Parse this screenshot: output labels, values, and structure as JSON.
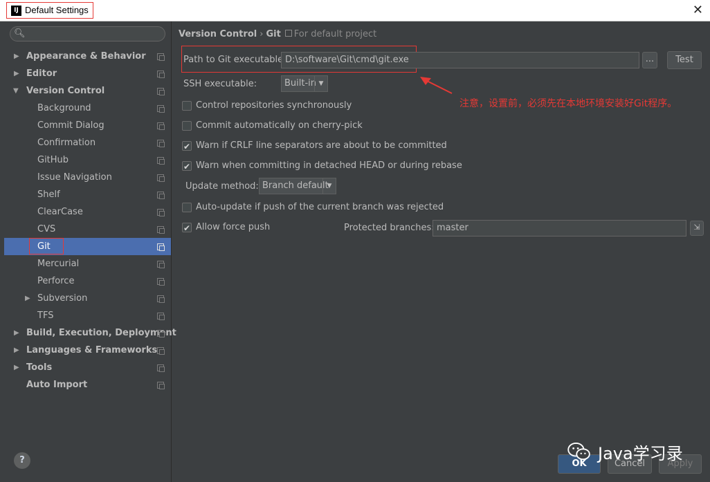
{
  "window": {
    "title": "Default Settings"
  },
  "search": {
    "placeholder": ""
  },
  "sidebar": {
    "items": [
      {
        "label": "Appearance & Behavior"
      },
      {
        "label": "Editor"
      },
      {
        "label": "Version Control"
      },
      {
        "label": "Background"
      },
      {
        "label": "Commit Dialog"
      },
      {
        "label": "Confirmation"
      },
      {
        "label": "GitHub"
      },
      {
        "label": "Issue Navigation"
      },
      {
        "label": "Shelf"
      },
      {
        "label": "ClearCase"
      },
      {
        "label": "CVS"
      },
      {
        "label": "Git"
      },
      {
        "label": "Mercurial"
      },
      {
        "label": "Perforce"
      },
      {
        "label": "Subversion"
      },
      {
        "label": "TFS"
      },
      {
        "label": "Build, Execution, Deployment"
      },
      {
        "label": "Languages & Frameworks"
      },
      {
        "label": "Tools"
      },
      {
        "label": "Auto Import"
      }
    ]
  },
  "breadcrumb": {
    "parent": "Version Control",
    "separator": "›",
    "current": "Git",
    "note": "For default project"
  },
  "git": {
    "path_label": "Path to Git executable:",
    "path_value": "D:\\software\\Git\\cmd\\git.exe",
    "browse_label": "...",
    "test_label": "Test",
    "ssh_label": "SSH executable:",
    "ssh_value": "Built-in",
    "control_sync": {
      "label": "Control repositories synchronously",
      "checked": false
    },
    "commit_cherry": {
      "label": "Commit automatically on cherry-pick",
      "checked": false
    },
    "warn_crlf": {
      "label": "Warn if CRLF line separators are about to be committed",
      "checked": true
    },
    "warn_detached": {
      "label": "Warn when committing in detached HEAD or during rebase",
      "checked": true
    },
    "update_method_label": "Update method:",
    "update_method_value": "Branch default",
    "auto_update": {
      "label": "Auto-update if push of the current branch was rejected",
      "checked": false
    },
    "force_push": {
      "label": "Allow force push",
      "checked": true
    },
    "protected_label": "Protected branches:",
    "protected_value": "master"
  },
  "annotation": {
    "text": "注意，设置前，必须先在本地环境安装好Git程序。"
  },
  "footer": {
    "help_label": "?",
    "ok_label": "OK",
    "cancel_label": "Cancel",
    "apply_label": "Apply"
  },
  "watermark": {
    "text": "Java学习录"
  },
  "colors": {
    "selection": "#4b6eaf",
    "annotation": "#e53935",
    "background": "#3c3f41"
  }
}
